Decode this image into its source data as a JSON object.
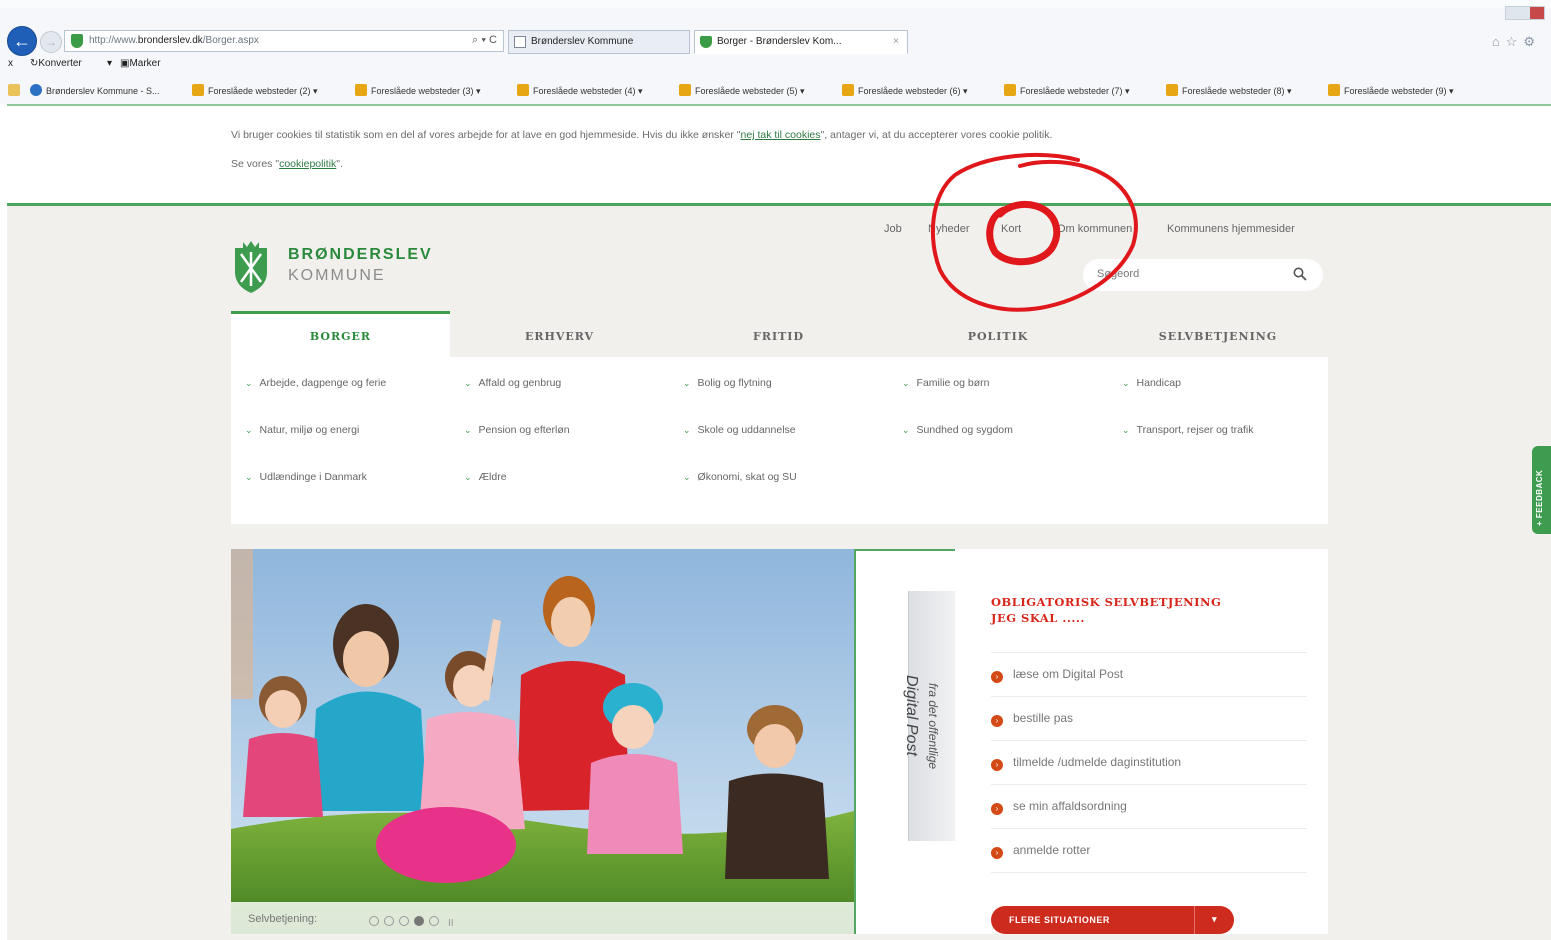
{
  "browser": {
    "url_prefix": "http://www.",
    "url_host": "bronderslev.dk",
    "url_path": "/Borger.aspx",
    "addr_controls": "⌕ ▾ C",
    "tabs": [
      {
        "label": "Brønderslev Kommune"
      },
      {
        "label": "Borger - Brønderslev Kom...",
        "close": "×"
      }
    ],
    "command_bar": {
      "x": "x",
      "convert": "Konverter",
      "convert_caret": "▾",
      "select": "Marker"
    },
    "favorites": [
      {
        "label": "Brønderslev Kommune - S..."
      },
      {
        "label": "Foreslåede websteder (2) ▾"
      },
      {
        "label": "Foreslåede websteder (3) ▾"
      },
      {
        "label": "Foreslåede websteder (4) ▾"
      },
      {
        "label": "Foreslåede websteder (5) ▾"
      },
      {
        "label": "Foreslåede websteder (6) ▾"
      },
      {
        "label": "Foreslåede websteder (7) ▾"
      },
      {
        "label": "Foreslåede websteder (8) ▾"
      },
      {
        "label": "Foreslåede websteder (9) ▾"
      }
    ]
  },
  "cookie": {
    "line1_a": "Vi bruger cookies til statistik som en del af vores arbejde for at lave en god hjemmeside. Hvis du ikke ønsker \"",
    "decline_link": "nej tak til cookies",
    "line1_b": "\", antager vi, at du accepterer vores cookie politik.",
    "line2_a": "Se vores \"",
    "policy_link": "cookiepolitik",
    "line2_b": "\"."
  },
  "logo": {
    "line1": "BRØNDERSLEV",
    "line2": "KOMMUNE"
  },
  "top_nav": [
    "Job",
    "Nyheder",
    "Kort",
    "Om kommunen",
    "Kommunens hjemmesider"
  ],
  "search": {
    "placeholder": "Søgeord"
  },
  "main_nav": [
    "BORGER",
    "ERHVERV",
    "FRITID",
    "POLITIK",
    "SELVBETJENING"
  ],
  "borger_links": [
    "Arbejde, dagpenge og ferie",
    "Affald og genbrug",
    "Bolig og flytning",
    "Familie og børn",
    "Handicap",
    "Natur, miljø og energi",
    "Pension og efterløn",
    "Skole og uddannelse",
    "Sundhed og sygdom",
    "Transport, rejser og trafik",
    "Udlændinge i Danmark",
    "Ældre",
    "Økonomi, skat og SU"
  ],
  "hero": {
    "caption": "Selvbetjening:",
    "pause": "II",
    "slides": 5,
    "active_slide": 4
  },
  "promo": {
    "vertical_title": "Digital Post",
    "vertical_sub": "fra det offentlige"
  },
  "self_service": {
    "title_line1": "OBLIGATORISK SELVBETJENING",
    "title_line2": "JEG SKAL .....",
    "items": [
      "læse om Digital Post",
      "bestille pas",
      "tilmelde /udmelde daginstitution",
      "se min affaldsordning",
      "anmelde rotter"
    ],
    "more_button": "FLERE SITUATIONER",
    "item_bullet": "›",
    "more_caret": "▾"
  },
  "feedback": "+ FEEDBACK",
  "colors": {
    "brand_green": "#2a8a3c",
    "accent_red": "#cc2b1d",
    "annotation_red": "#e0171b"
  }
}
